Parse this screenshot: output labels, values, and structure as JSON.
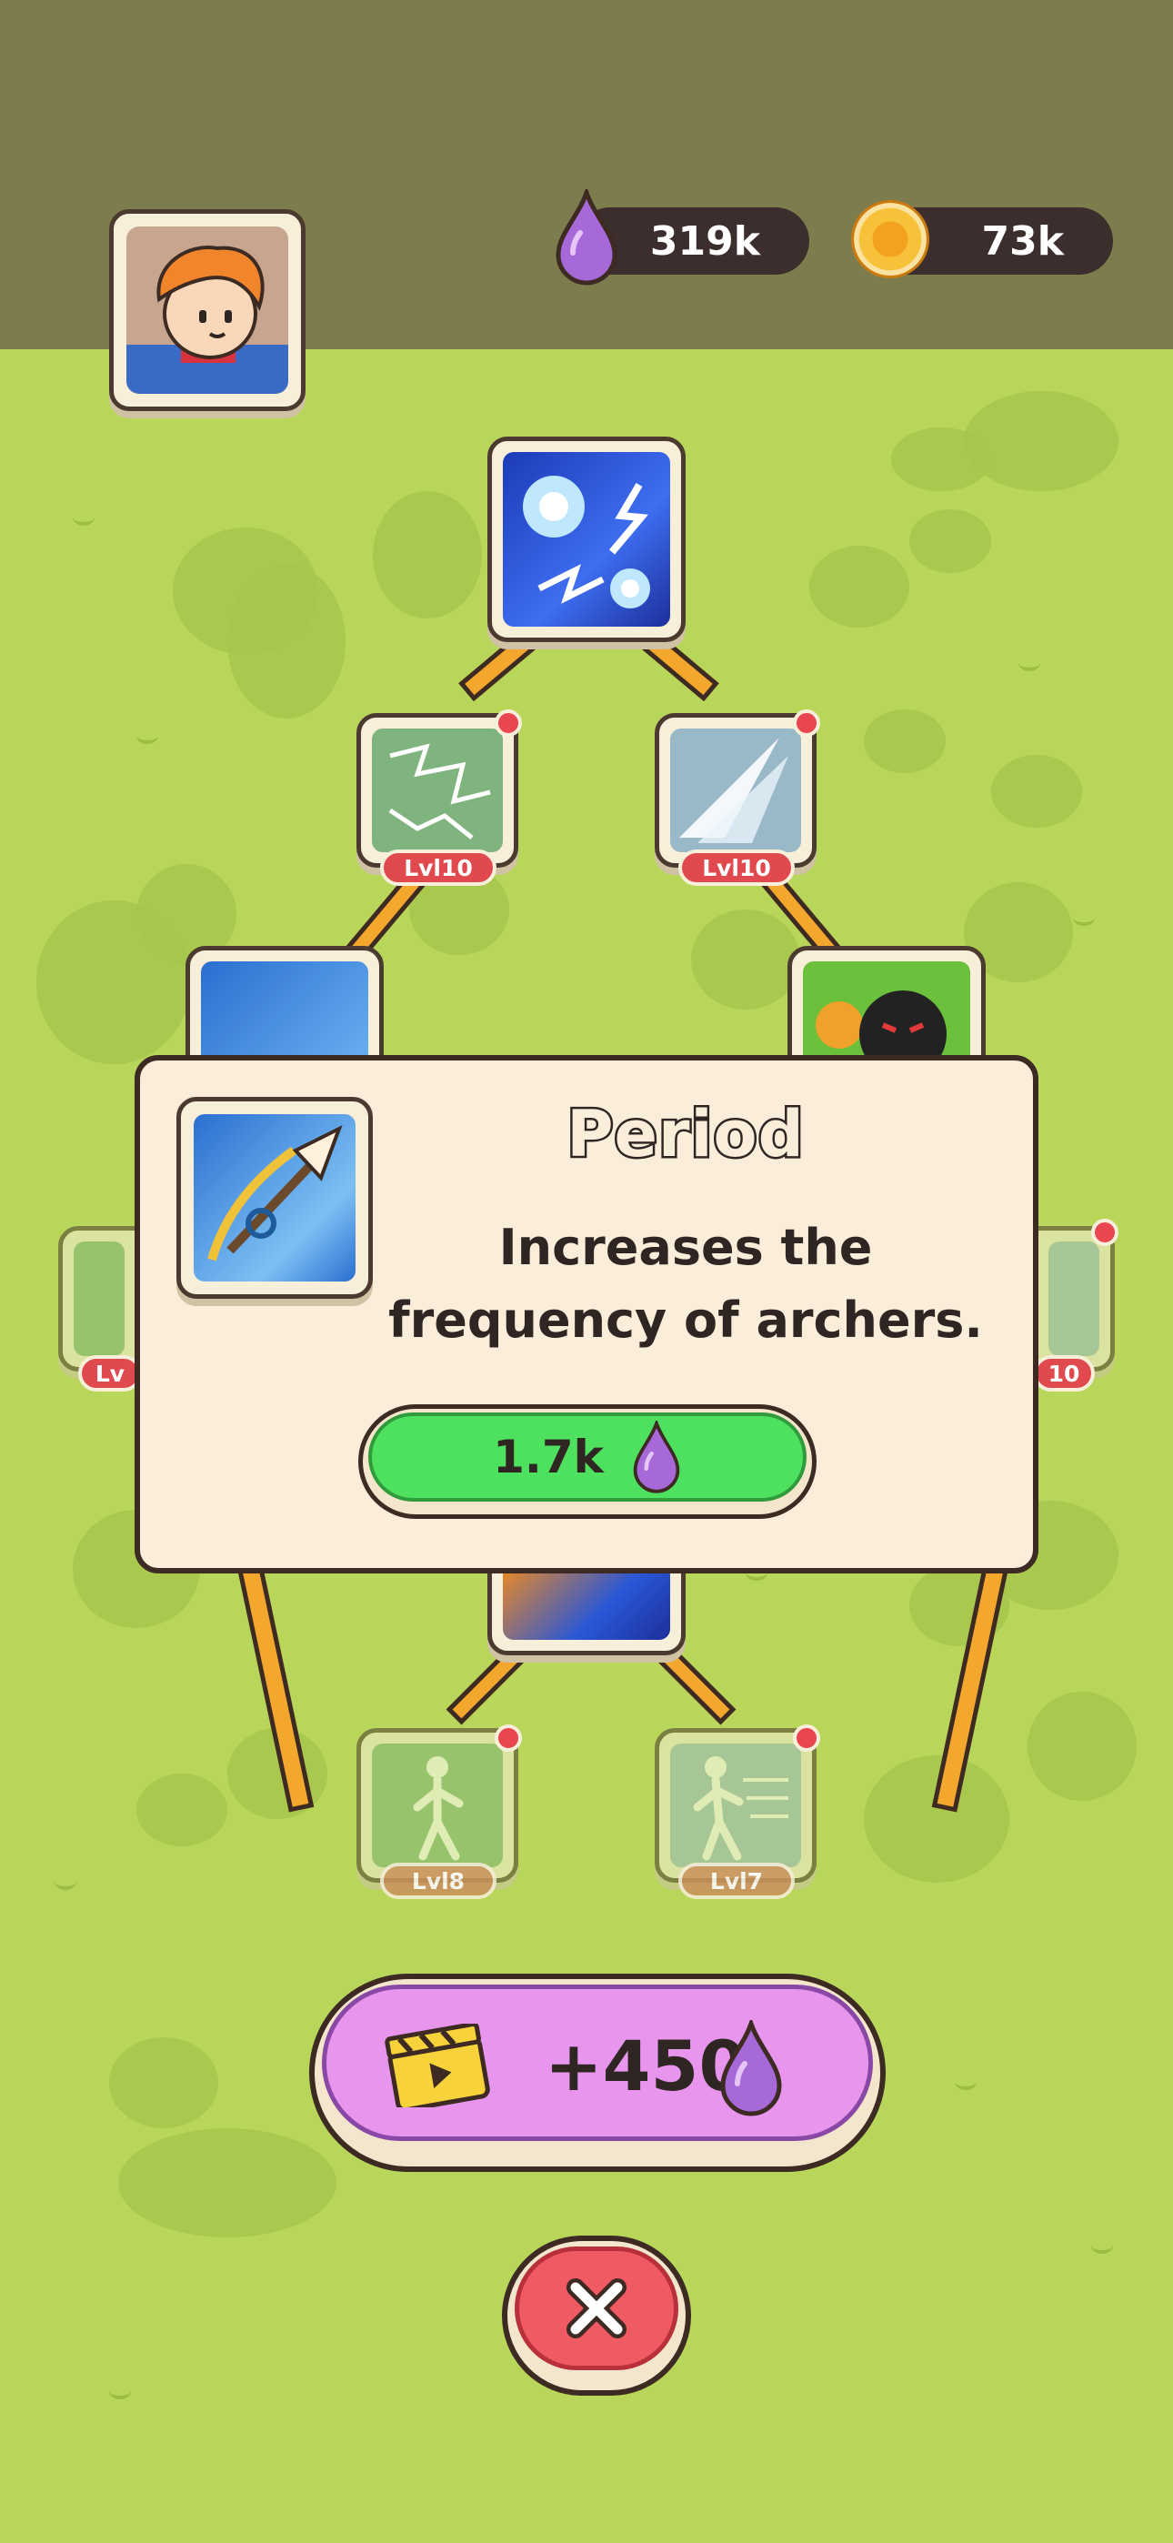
{
  "currency": {
    "elixir": "319k",
    "coins": "73k"
  },
  "skill_tree": {
    "nodes": [
      {
        "id": "top",
        "level": null
      },
      {
        "id": "lightning",
        "level": "Lvl10"
      },
      {
        "id": "claw",
        "level": "Lvl10"
      },
      {
        "id": "arrow",
        "level": null
      },
      {
        "id": "dark-archer",
        "level": null
      },
      {
        "id": "left-edge",
        "level": "Lv"
      },
      {
        "id": "right-edge",
        "level": "10"
      },
      {
        "id": "dash-left",
        "level": "Lvl8"
      },
      {
        "id": "dash-right",
        "level": "Lvl7"
      }
    ]
  },
  "popup": {
    "title": "Period",
    "description_line1": "Increases the",
    "description_line2": "frequency of archers.",
    "cost": "1.7k"
  },
  "reward": {
    "amount": "+450"
  },
  "colors": {
    "grass": "#b8d65a",
    "elixir": "#a768d8",
    "buy_button": "#4ee05f",
    "reward_button": "#e895ee",
    "close_button": "#f05a62"
  }
}
